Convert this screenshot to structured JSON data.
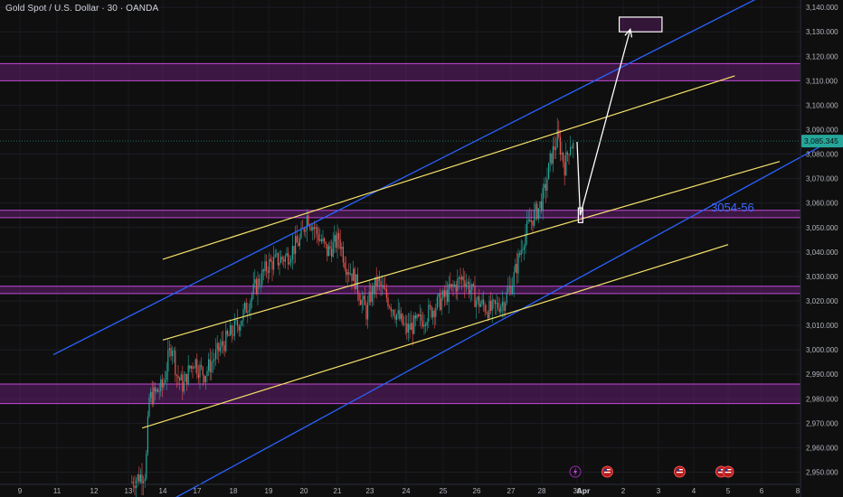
{
  "header": {
    "title": "Gold Spot / U.S. Dollar · 30 · OANDA"
  },
  "chart_data": {
    "type": "candlestick",
    "title": "Gold Spot / U.S. Dollar · 30 · OANDA",
    "ylim": [
      2945,
      3143
    ],
    "y_ticks": [
      2950,
      2960,
      2970,
      2980,
      2990,
      3000,
      3010,
      3020,
      3030,
      3040,
      3050,
      3060,
      3070,
      3080,
      3090,
      3100,
      3110,
      3120,
      3130,
      3140
    ],
    "x_ticks": [
      {
        "label": "9",
        "day": 9
      },
      {
        "label": "11",
        "day": 11
      },
      {
        "label": "12",
        "day": 12
      },
      {
        "label": "13",
        "day": 13
      },
      {
        "label": "14",
        "day": 14
      },
      {
        "label": "17",
        "day": 17
      },
      {
        "label": "18",
        "day": 18
      },
      {
        "label": "19",
        "day": 19
      },
      {
        "label": "20",
        "day": 20
      },
      {
        "label": "21",
        "day": 21
      },
      {
        "label": "23",
        "day": 23
      },
      {
        "label": "24",
        "day": 24
      },
      {
        "label": "25",
        "day": 25
      },
      {
        "label": "26",
        "day": 26
      },
      {
        "label": "27",
        "day": 27
      },
      {
        "label": "28",
        "day": 28
      },
      {
        "label": "30",
        "day": 30
      },
      {
        "label": "Apr",
        "day": 31
      },
      {
        "label": "2",
        "day": 32
      },
      {
        "label": "3",
        "day": 33
      },
      {
        "label": "4",
        "day": 34
      },
      {
        "label": "5",
        "day": 35
      },
      {
        "label": "6",
        "day": 36
      },
      {
        "label": "8",
        "day": 37
      }
    ],
    "last_price": "3,085.345",
    "last_value": 3085.345,
    "annotation": "3054-56",
    "annotation_value": 3058,
    "colors": {
      "up": "#26a69a",
      "down": "#ef5350",
      "zone": "#9c27b0",
      "channel_blue": "#2962ff",
      "channel_yellow": "#f7e26b",
      "arrow": "#ffffff",
      "tag": "#26a69a",
      "annotation": "#3d6bff"
    },
    "zones": [
      [
        3110,
        3117
      ],
      [
        3054,
        3057
      ],
      [
        3023,
        3026
      ],
      [
        2978,
        2986
      ]
    ],
    "blue_channel": [
      {
        "from": {
          "day": 10.8,
          "value": 2998
        },
        "to": {
          "day": 37,
          "value": 3152
        }
      },
      {
        "from": {
          "day": 14.5,
          "value": 2938
        },
        "to": {
          "day": 37.9,
          "value": 3085
        }
      }
    ],
    "yellow_channel": [
      {
        "from": {
          "day": 14,
          "value": 3037
        },
        "to": {
          "day": 35.2,
          "value": 3112
        }
      },
      {
        "from": {
          "day": 14,
          "value": 3004
        },
        "to": {
          "day": 36.5,
          "value": 3077
        }
      },
      {
        "from": {
          "day": 13.4,
          "value": 2968
        },
        "to": {
          "day": 35,
          "value": 3043
        }
      }
    ],
    "projection": [
      {
        "day": 30,
        "value": 3085
      },
      {
        "day": 30.5,
        "value": 3055
      },
      {
        "day": 32.2,
        "value": 3131
      }
    ],
    "target_boxes": [
      {
        "day_from": 30.2,
        "day_to": 30.9,
        "v_from": 3052,
        "v_to": 3058
      },
      {
        "day_from": 31.9,
        "day_to": 33.1,
        "v_from": 3130,
        "v_to": 3136
      }
    ],
    "price_path": [
      {
        "day": 13.1,
        "value": 2946
      },
      {
        "day": 13.5,
        "value": 2950
      },
      {
        "day": 13.6,
        "value": 2980
      },
      {
        "day": 14,
        "value": 2985
      },
      {
        "day": 14.5,
        "value": 2997
      },
      {
        "day": 14.8,
        "value": 3003
      },
      {
        "day": 15.2,
        "value": 2990
      },
      {
        "day": 15.8,
        "value": 2985
      },
      {
        "day": 16.3,
        "value": 2992
      },
      {
        "day": 16.8,
        "value": 2996
      },
      {
        "day": 17.2,
        "value": 2990
      },
      {
        "day": 17.6,
        "value": 3000
      },
      {
        "day": 18.2,
        "value": 3012
      },
      {
        "day": 18.6,
        "value": 3025
      },
      {
        "day": 19,
        "value": 3035
      },
      {
        "day": 19.5,
        "value": 3038
      },
      {
        "day": 19.9,
        "value": 3045
      },
      {
        "day": 20.1,
        "value": 3055
      },
      {
        "day": 20.3,
        "value": 3050
      },
      {
        "day": 20.7,
        "value": 3040
      },
      {
        "day": 21.1,
        "value": 3046
      },
      {
        "day": 21.5,
        "value": 3035
      },
      {
        "day": 22,
        "value": 3030
      },
      {
        "day": 22.4,
        "value": 3022
      },
      {
        "day": 22.8,
        "value": 3015
      },
      {
        "day": 23.2,
        "value": 3028
      },
      {
        "day": 23.6,
        "value": 3018
      },
      {
        "day": 24,
        "value": 3008
      },
      {
        "day": 24.4,
        "value": 3012
      },
      {
        "day": 24.8,
        "value": 3018
      },
      {
        "day": 25.2,
        "value": 3024
      },
      {
        "day": 25.6,
        "value": 3030
      },
      {
        "day": 26,
        "value": 3020
      },
      {
        "day": 26.4,
        "value": 3016
      },
      {
        "day": 26.8,
        "value": 3020
      },
      {
        "day": 27.1,
        "value": 3030
      },
      {
        "day": 27.4,
        "value": 3045
      },
      {
        "day": 27.6,
        "value": 3052
      },
      {
        "day": 27.9,
        "value": 3058
      },
      {
        "day": 28.2,
        "value": 3066
      },
      {
        "day": 28.5,
        "value": 3078
      },
      {
        "day": 28.9,
        "value": 3087
      },
      {
        "day": 29.3,
        "value": 3075
      },
      {
        "day": 29.6,
        "value": 3085
      },
      {
        "day": 29.8,
        "value": 3083
      }
    ]
  }
}
